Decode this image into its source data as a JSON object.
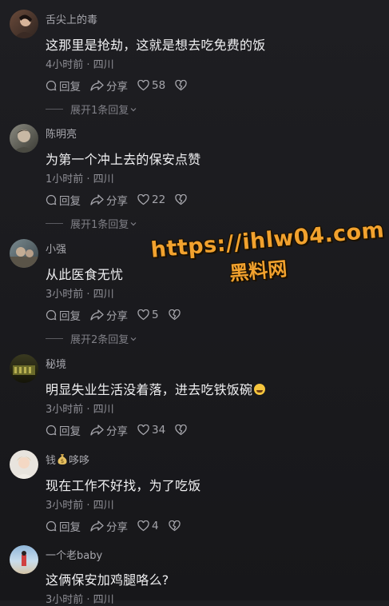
{
  "comments": [
    {
      "username": "舌尖上的毒",
      "text": "这那里是抢劫，这就是想去吃免费的饭",
      "meta": "4小时前 · 四川",
      "reply": "回复",
      "share": "分享",
      "likes": "58",
      "expand": "展开1条回复"
    },
    {
      "username": "陈明亮",
      "text": "为第一个冲上去的保安点赞",
      "meta": "1小时前 · 四川",
      "reply": "回复",
      "share": "分享",
      "likes": "22",
      "expand": "展开1条回复"
    },
    {
      "username": "小强",
      "text": "从此医食无忧",
      "meta": "3小时前 · 四川",
      "reply": "回复",
      "share": "分享",
      "likes": "5",
      "expand": "展开2条回复"
    },
    {
      "username": "秘境",
      "text": "明显失业生活没着落，进去吃铁饭碗",
      "meta": "3小时前 · 四川",
      "reply": "回复",
      "share": "分享",
      "likes": "34"
    },
    {
      "username_a": "钱",
      "username_b": "哆哆",
      "text": "现在工作不好找，为了吃饭",
      "meta": "3小时前 · 四川",
      "reply": "回复",
      "share": "分享",
      "likes": "4"
    },
    {
      "username": "一个老baby",
      "text": "这俩保安加鸡腿咯么?",
      "meta": "3小时前 · 四川"
    }
  ],
  "watermark": {
    "url": "https://ihlw04.com",
    "name": "黑料网"
  },
  "icons": [
    "reply-icon",
    "share-icon",
    "heart-icon",
    "dislike-icon",
    "chevron-down-icon",
    "laughing-emoji-icon",
    "money-bag-icon"
  ]
}
